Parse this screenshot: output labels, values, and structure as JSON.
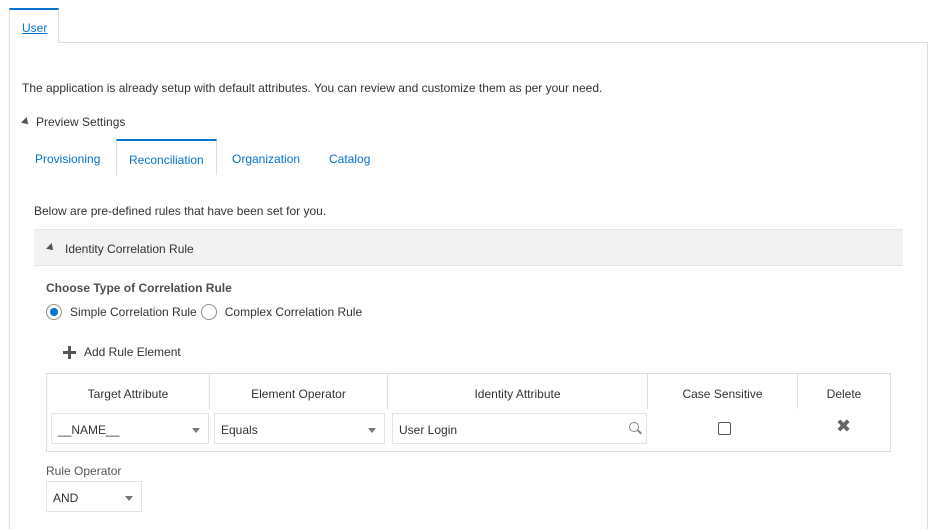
{
  "top_tabs": [
    {
      "label": "User"
    }
  ],
  "intro_text": "The application is already setup with default attributes. You can review and customize them as per your need.",
  "preview_settings": {
    "label": "Preview Settings"
  },
  "subtabs": [
    {
      "label": "Provisioning"
    },
    {
      "label": "Reconciliation"
    },
    {
      "label": "Organization"
    },
    {
      "label": "Catalog"
    }
  ],
  "rules_intro": "Below are pre-defined rules that have been set for you.",
  "identity_section": {
    "title": "Identity Correlation Rule"
  },
  "correlation": {
    "heading": "Choose Type of Correlation Rule",
    "options": [
      {
        "label": "Simple Correlation Rule",
        "checked": true
      },
      {
        "label": "Complex Correlation Rule",
        "checked": false
      }
    ]
  },
  "add_rule_label": "Add Rule Element",
  "table": {
    "headers": [
      "Target Attribute",
      "Element Operator",
      "Identity Attribute",
      "Case Sensitive",
      "Delete"
    ],
    "row": {
      "target_attribute": "__NAME__",
      "element_operator": "Equals",
      "identity_attribute": "User Login",
      "case_sensitive": false
    }
  },
  "rule_operator": {
    "label": "Rule Operator",
    "value": "AND"
  },
  "colors": {
    "accent": "#0572ce",
    "border": "#d6dfe6",
    "section_bg": "#f2f2f2"
  },
  "icons": [
    "disclosure-triangle-icon",
    "plus-icon",
    "search-icon",
    "delete-x-icon",
    "chevron-down-icon"
  ]
}
